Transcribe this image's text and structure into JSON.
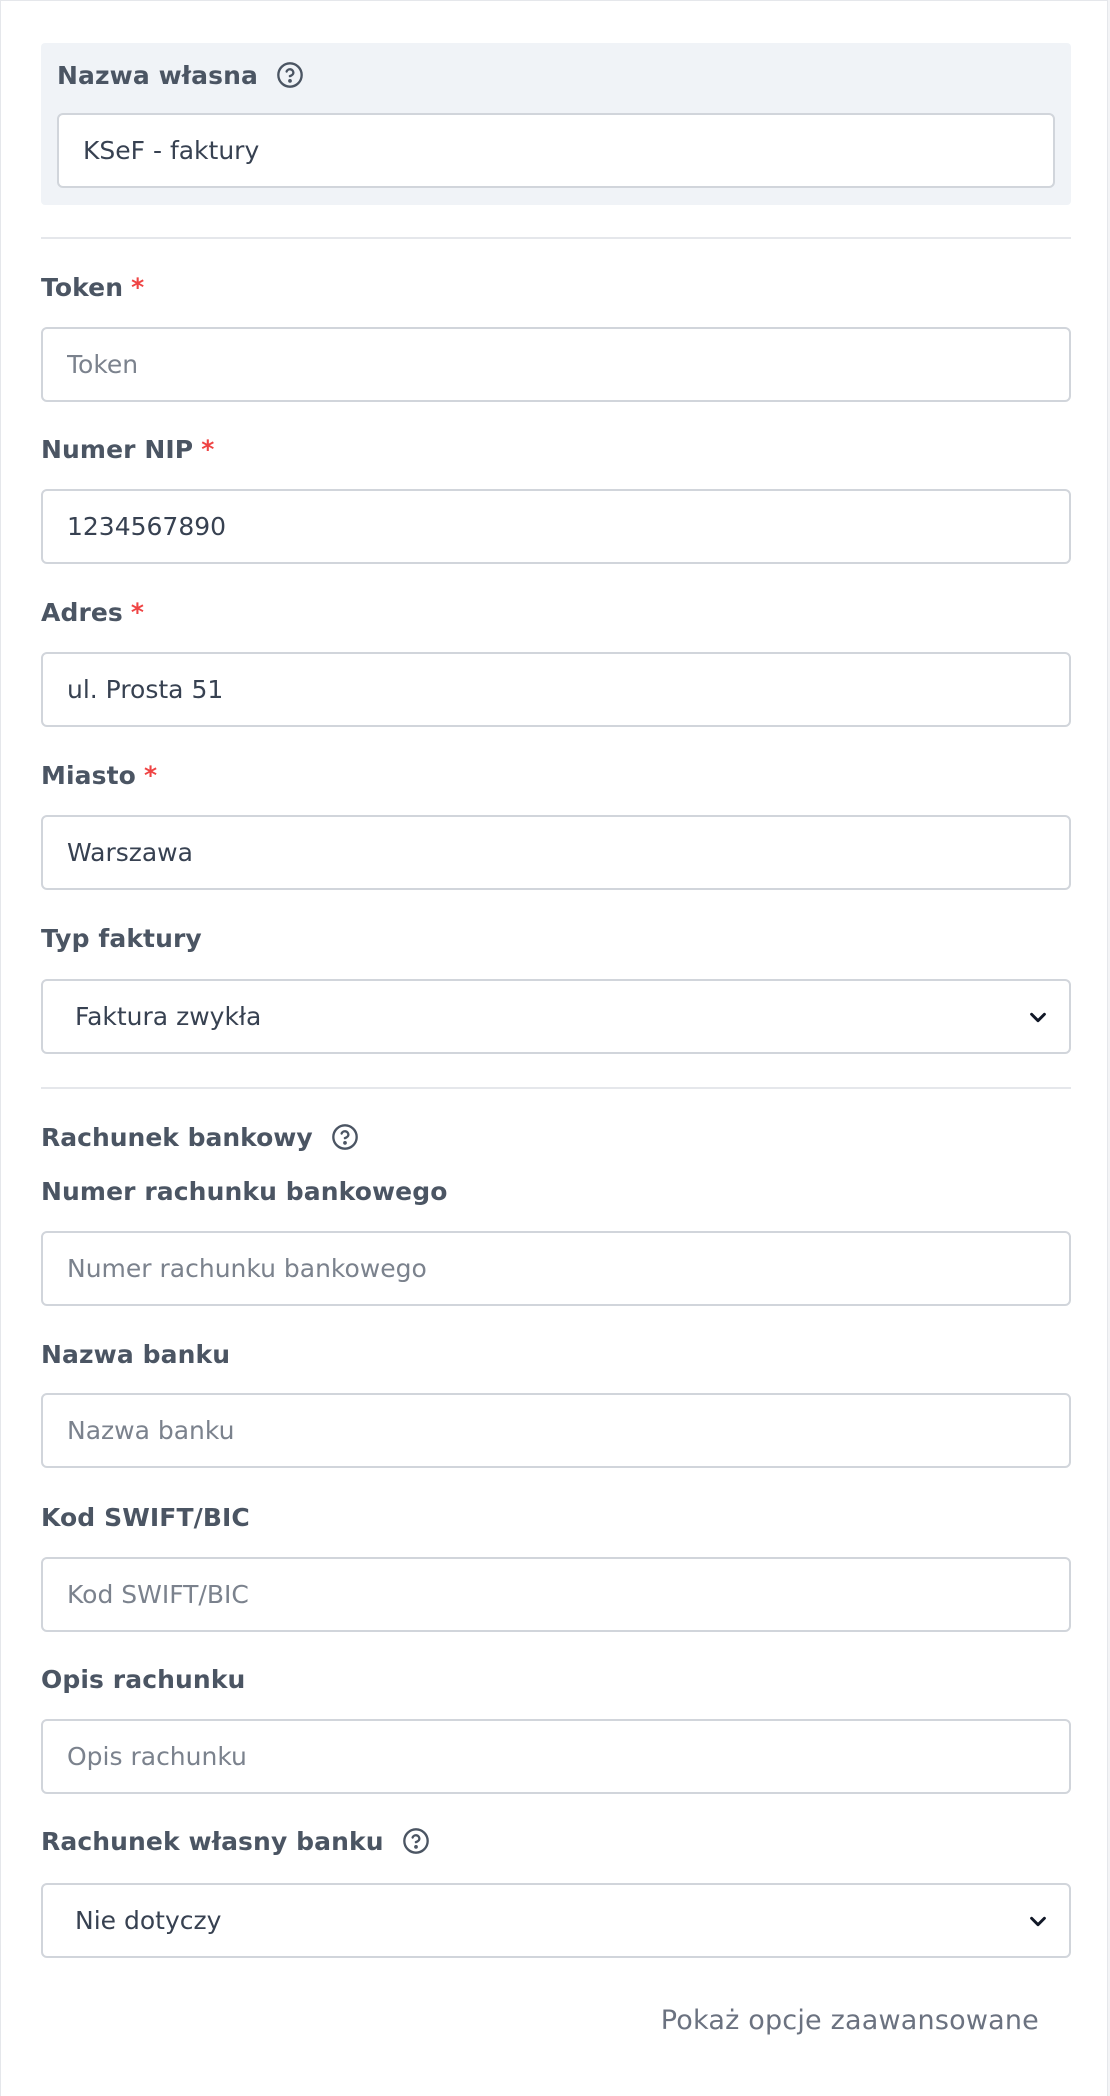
{
  "name_section": {
    "label": "Nazwa własna",
    "value": "KSeF - faktury"
  },
  "required_marker": "*",
  "fields": {
    "token": {
      "label": "Token",
      "placeholder": "Token",
      "value": ""
    },
    "nip": {
      "label": "Numer NIP",
      "value": "1234567890"
    },
    "address": {
      "label": "Adres",
      "value": "ul. Prosta 51"
    },
    "city": {
      "label": "Miasto",
      "value": "Warszawa"
    },
    "invoice_type": {
      "label": "Typ faktury",
      "selected": "Faktura zwykła"
    }
  },
  "bank_account": {
    "title": "Rachunek bankowy",
    "account_number": {
      "label": "Numer rachunku bankowego",
      "placeholder": "Numer rachunku bankowego"
    },
    "bank_name": {
      "label": "Nazwa banku",
      "placeholder": "Nazwa banku"
    },
    "swift": {
      "label": "Kod SWIFT/BIC",
      "placeholder": "Kod SWIFT/BIC"
    },
    "description": {
      "label": "Opis rachunku",
      "placeholder": "Opis rachunku"
    },
    "own_account": {
      "label": "Rachunek własny banku",
      "selected": "Nie dotyczy"
    }
  },
  "advanced_link": "Pokaż opcje zaawansowane",
  "icons": {
    "help": "question-circle-icon",
    "chevron": "chevron-down-icon"
  },
  "colors": {
    "required": "#ef4444",
    "section_bg": "#f0f3f7",
    "border": "#d1d5db"
  }
}
